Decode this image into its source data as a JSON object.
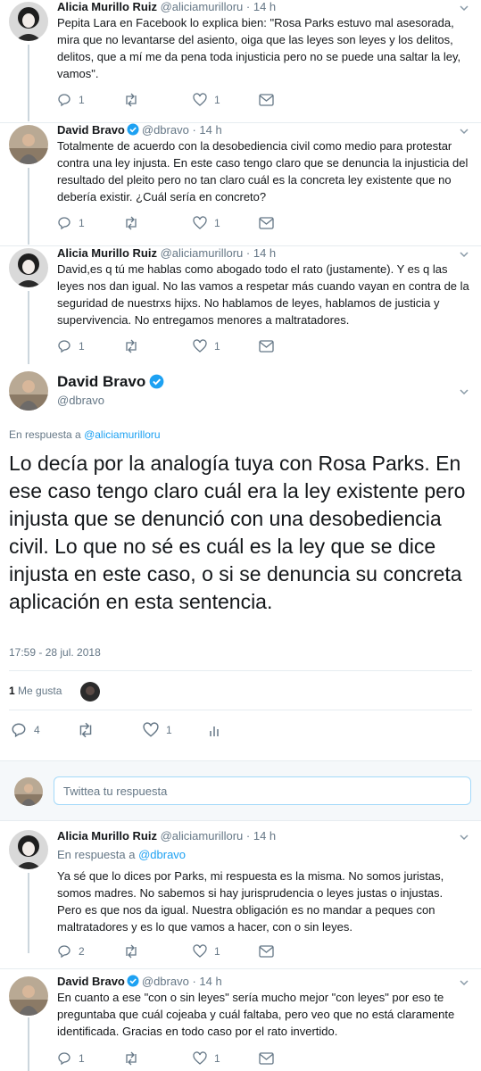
{
  "tweets": [
    {
      "name": "Alicia Murillo Ruiz",
      "handle": "@aliciamurilloru",
      "time": "14 h",
      "text": "Pepita Lara en Facebook lo explica bien: \"Rosa Parks estuvo mal asesorada, mira que no levantarse del asiento, oiga que las leyes son leyes y los delitos, delitos, que a mí me da pena toda injusticia pero no se puede una saltar la ley, vamos\".",
      "replies": "1",
      "retweets": "",
      "likes": "1"
    },
    {
      "name": "David Bravo",
      "handle": "@dbravo",
      "time": "14 h",
      "text": "Totalmente de acuerdo con la desobediencia civil como medio para protestar contra una ley injusta. En este caso tengo claro que se denuncia la injusticia del resultado del pleito pero no tan claro cuál es la concreta ley existente que no debería existir. ¿Cuál sería en concreto?",
      "replies": "1",
      "retweets": "",
      "likes": "1"
    },
    {
      "name": "Alicia Murillo Ruiz",
      "handle": "@aliciamurilloru",
      "time": "14 h",
      "text": "David,es q tú me hablas como abogado todo el rato (justamente). Y es q las leyes nos dan igual. No las vamos a respetar más cuando vayan en contra de la seguridad de nuestrxs hijxs. No hablamos de leyes, hablamos de justicia y supervivencia. No entregamos menores a maltratadores.",
      "replies": "1",
      "retweets": "",
      "likes": "1"
    }
  ],
  "main": {
    "name": "David Bravo",
    "handle": "@dbravo",
    "reply_prefix": "En respuesta a",
    "reply_to": "@aliciamurilloru",
    "text": "Lo decía por la analogía tuya con Rosa Parks. En ese caso tengo claro cuál era la ley existente pero injusta que se denunció con una desobediencia civil. Lo que no sé es cuál es la ley que se dice injusta en este caso, o si se denuncia su concreta aplicación en esta sentencia.",
    "timestamp": "17:59 - 28 jul. 2018",
    "likes_count": "1",
    "likes_label": "Me gusta",
    "replies": "4",
    "retweets": "",
    "likes": "1"
  },
  "reply_box": {
    "placeholder": "Twittea tu respuesta"
  },
  "replies": [
    {
      "name": "Alicia Murillo Ruiz",
      "handle": "@aliciamurilloru",
      "time": "14 h",
      "reply_prefix": "En respuesta a",
      "reply_to": "@dbravo",
      "text": "Ya sé que lo dices por Parks, mi respuesta es la misma. No somos juristas, somos madres. No sabemos si hay jurisprudencia o leyes justas o injustas. Pero es que nos da igual. Nuestra obligación es no mandar a peques con maltratadores y es lo que vamos a hacer, con o sin leyes.",
      "replies": "2",
      "retweets": "",
      "likes": "1"
    },
    {
      "name": "David Bravo",
      "handle": "@dbravo",
      "time": "14 h",
      "text": "En cuanto a ese \"con o sin leyes\" sería mucho mejor \"con leyes\" por eso te preguntaba que cuál cojeaba y cuál faltaba, pero veo que no está claramente identificada. Gracias en todo caso por el rato invertido.",
      "replies": "1",
      "retweets": "",
      "likes": "1"
    }
  ],
  "colors": {
    "accent": "#1da1f2",
    "text": "#14171a",
    "muted": "#657786",
    "border": "#e6ecf0",
    "thread": "#ccd6dd"
  },
  "icons": [
    "reply-icon",
    "retweet-icon",
    "like-icon",
    "dm-icon",
    "analytics-icon",
    "verified-icon",
    "chevron-down-icon"
  ]
}
